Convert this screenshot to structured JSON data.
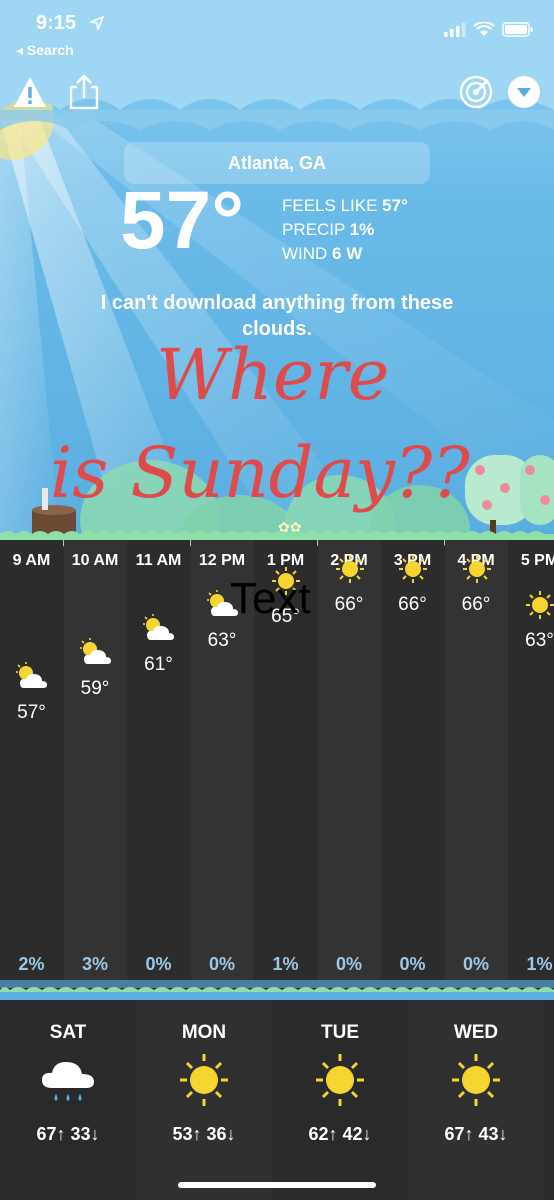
{
  "status_bar": {
    "time": "9:15",
    "back_label": "◂ Search"
  },
  "toolbar": {
    "location": "Atlanta, GA"
  },
  "current": {
    "temp": "57°",
    "feels_label": "FEELS LIKE ",
    "feels_value": "57°",
    "precip_label": "PRECIP ",
    "precip_value": "1%",
    "wind_label": "WIND ",
    "wind_value": "6 W",
    "quip": "I can't download anything from these clouds."
  },
  "annotations": {
    "line1": "Where",
    "line2": "is Sunday??",
    "text_overlay": "Text"
  },
  "hourly": [
    {
      "time": "9 AM",
      "temp": "57°",
      "precip": "2%",
      "icon": "partly-cloudy-icon"
    },
    {
      "time": "10 AM",
      "temp": "59°",
      "precip": "3%",
      "icon": "partly-cloudy-icon"
    },
    {
      "time": "11 AM",
      "temp": "61°",
      "precip": "0%",
      "icon": "partly-cloudy-icon"
    },
    {
      "time": "12 PM",
      "temp": "63°",
      "precip": "0%",
      "icon": "partly-cloudy-icon"
    },
    {
      "time": "1 PM",
      "temp": "65°",
      "precip": "1%",
      "icon": "sun-icon"
    },
    {
      "time": "2 PM",
      "temp": "66°",
      "precip": "0%",
      "icon": "sun-icon"
    },
    {
      "time": "3 PM",
      "temp": "66°",
      "precip": "0%",
      "icon": "sun-icon"
    },
    {
      "time": "4 PM",
      "temp": "66°",
      "precip": "0%",
      "icon": "sun-icon"
    },
    {
      "time": "5 PM",
      "temp": "63°",
      "precip": "1%",
      "icon": "sun-icon"
    }
  ],
  "daily": [
    {
      "day": "SAT",
      "range": "67↑ 33↓",
      "icon": "rain-cloud-icon"
    },
    {
      "day": "MON",
      "range": "53↑ 36↓",
      "icon": "sun-icon"
    },
    {
      "day": "TUE",
      "range": "62↑ 42↓",
      "icon": "sun-icon"
    },
    {
      "day": "WED",
      "range": "67↑ 43↓",
      "icon": "sun-icon"
    }
  ],
  "colors": {
    "accent_grass": "#8ee0a8",
    "annotation": "#e04a4a",
    "precip_text": "#9cc8e8",
    "sun": "#f6d531"
  }
}
